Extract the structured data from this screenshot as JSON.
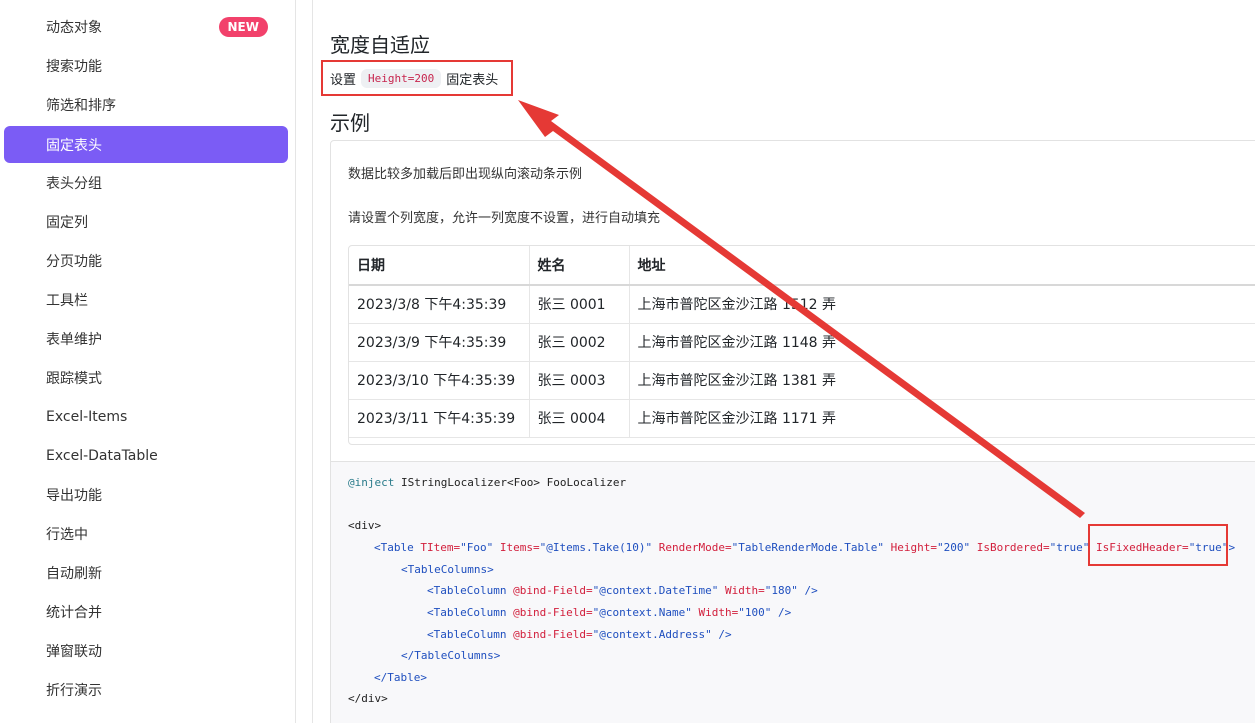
{
  "sidebar": {
    "items": [
      {
        "label": "动态对象",
        "badge": "NEW"
      },
      {
        "label": "搜索功能"
      },
      {
        "label": "筛选和排序"
      },
      {
        "label": "固定表头",
        "active": true
      },
      {
        "label": "表头分组"
      },
      {
        "label": "固定列"
      },
      {
        "label": "分页功能"
      },
      {
        "label": "工具栏"
      },
      {
        "label": "表单维护"
      },
      {
        "label": "跟踪模式"
      },
      {
        "label": "Excel-Items"
      },
      {
        "label": "Excel-DataTable"
      },
      {
        "label": "导出功能"
      },
      {
        "label": "行选中"
      },
      {
        "label": "自动刷新"
      },
      {
        "label": "统计合并"
      },
      {
        "label": "弹窗联动"
      },
      {
        "label": "折行演示"
      }
    ]
  },
  "main": {
    "section_title": "宽度自适应",
    "desc_prefix": "设置",
    "desc_code": "Height=200",
    "desc_suffix": "固定表头",
    "example_title": "示例",
    "example_text1": "数据比较多加载后即出现纵向滚动条示例",
    "example_text2": "请设置个列宽度，允许一列宽度不设置，进行自动填充",
    "table": {
      "headers": [
        "日期",
        "姓名",
        "地址"
      ],
      "rows": [
        [
          "2023/3/8 下午4:35:39",
          "张三 0001",
          "上海市普陀区金沙江路 1512 弄"
        ],
        [
          "2023/3/9 下午4:35:39",
          "张三 0002",
          "上海市普陀区金沙江路 1148 弄"
        ],
        [
          "2023/3/10 下午4:35:39",
          "张三 0003",
          "上海市普陀区金沙江路 1381 弄"
        ],
        [
          "2023/3/11 下午4:35:39",
          "张三 0004",
          "上海市普陀区金沙江路 1171 弄"
        ]
      ]
    },
    "code": {
      "inject_kw": "@inject",
      "inject_rest": " IStringLocalizer<Foo> FooLocalizer",
      "div_open": "<div>",
      "table_tag": "<Table",
      "titem_attr": " TItem=",
      "titem_val": "\"Foo\"",
      "items_attr": " Items=",
      "items_val": "\"@Items.Take(10)\"",
      "render_attr": " RenderMode=",
      "render_val": "\"TableRenderMode.Table\"",
      "height_attr": " Height=",
      "height_val": "\"200\"",
      "bordered_attr": " IsBordered=",
      "bordered_val": "\"true\"",
      "fixed_attr": " IsFixedHeader=",
      "fixed_val": "\"true\"",
      "table_close_bracket": ">",
      "columns_open": "<TableColumns>",
      "col_tag": "<TableColumn",
      "bind_attr": " @bind-Field=",
      "col1_val": "\"@context.DateTime\"",
      "width_attr": " Width=",
      "col1_width": "\"180\"",
      "col2_val": "\"@context.Name\"",
      "col2_width": "\"100\"",
      "col3_val": "\"@context.Address\"",
      "self_close": " />",
      "columns_close": "</TableColumns>",
      "table_close": "</Table>",
      "div_close": "</div>"
    }
  },
  "colors": {
    "accent": "#7b5cf5",
    "badge": "#f2416b",
    "annotation": "#e53935"
  }
}
